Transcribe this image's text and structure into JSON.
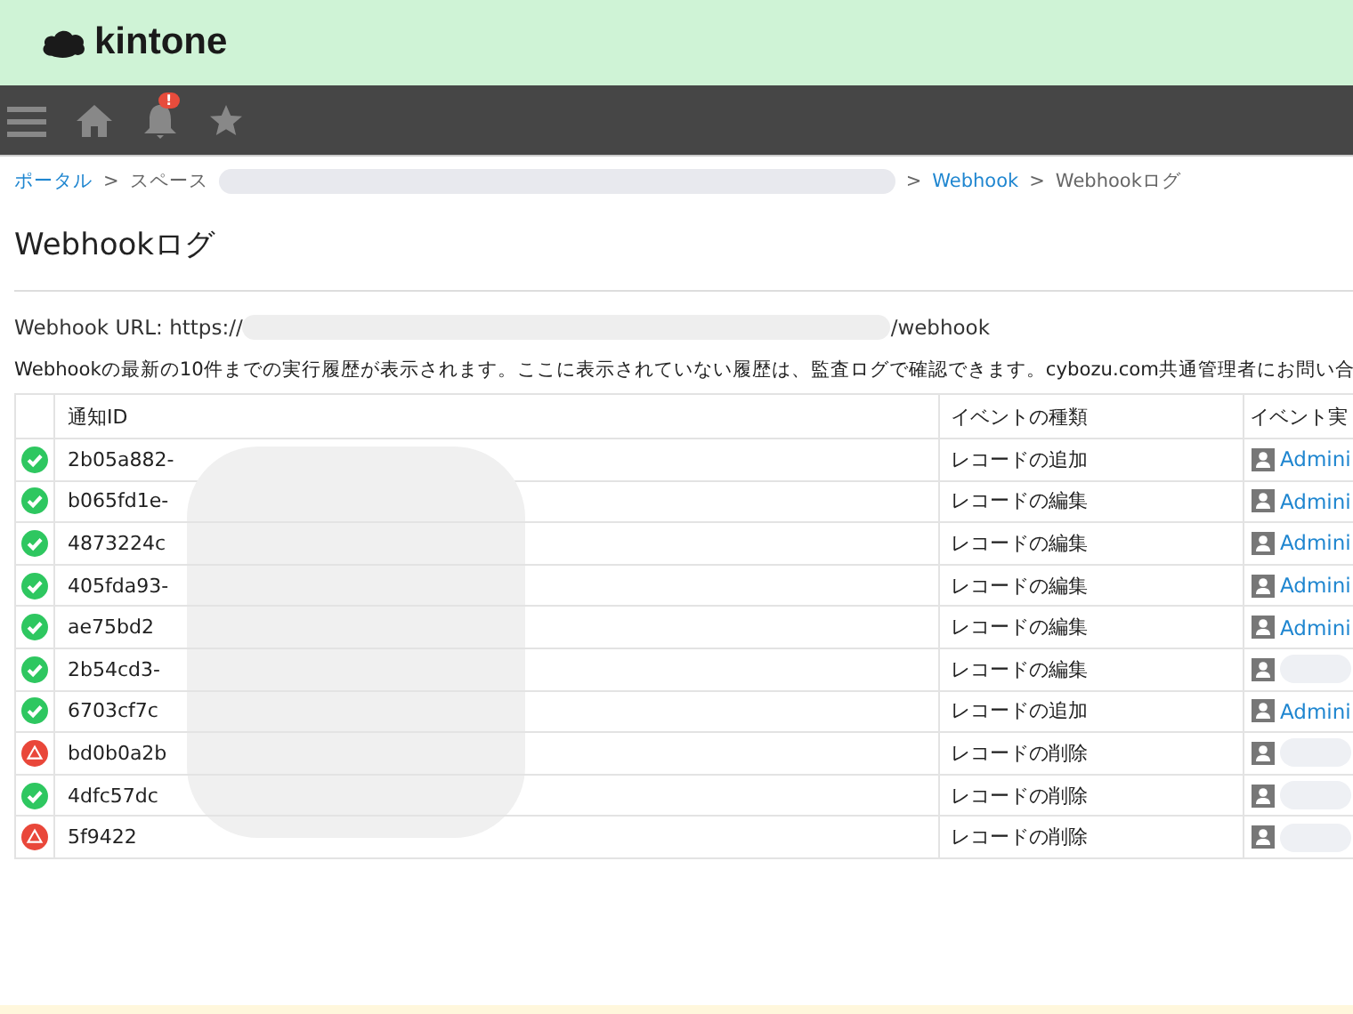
{
  "header": {
    "logo_text": "kintone"
  },
  "nav": {
    "notification_badge": "!"
  },
  "breadcrumb": {
    "separator": ">",
    "items": [
      {
        "label": "ポータル",
        "kind": "link"
      },
      {
        "label": "スペース",
        "kind": "text",
        "redacted": true
      },
      {
        "label": "Webhook",
        "kind": "link"
      },
      {
        "label": "Webhookログ",
        "kind": "text"
      }
    ]
  },
  "page_title": "Webhookログ",
  "webhook_url": {
    "prefix": "Webhook URL: https://",
    "suffix": "/webhook"
  },
  "description": "Webhookの最新の10件までの実行履歴が表示されます。ここに表示されていない履歴は、監査ログで確認できます。cybozu.com共通管理者にお問い合",
  "table": {
    "columns": [
      "通知ID",
      "イベントの種類",
      "イベント実"
    ],
    "rows": [
      {
        "kind": "success",
        "id": "2b05a882-",
        "event": "レコードの追加",
        "user": "Admini"
      },
      {
        "kind": "success",
        "id": "b065fd1e-",
        "event": "レコードの編集",
        "user": "Admini"
      },
      {
        "kind": "success",
        "id": "4873224c",
        "event": "レコードの編集",
        "user": "Admini"
      },
      {
        "kind": "success",
        "id": "405fda93-",
        "event": "レコードの編集",
        "user": "Admini"
      },
      {
        "kind": "success",
        "id": "ae75bd2",
        "event": "レコードの編集",
        "user": "Admini"
      },
      {
        "kind": "success",
        "id": "2b54cd3-",
        "event": "レコードの編集"
      },
      {
        "kind": "success",
        "id": "6703cf7c",
        "event": "レコードの追加",
        "user": "Admini"
      },
      {
        "kind": "error",
        "id": "bd0b0a2b",
        "event": "レコードの削除"
      },
      {
        "kind": "success",
        "id": "4dfc57dc",
        "event": "レコードの削除"
      },
      {
        "kind": "error",
        "id": "5f9422",
        "event": "レコードの削除"
      }
    ]
  }
}
